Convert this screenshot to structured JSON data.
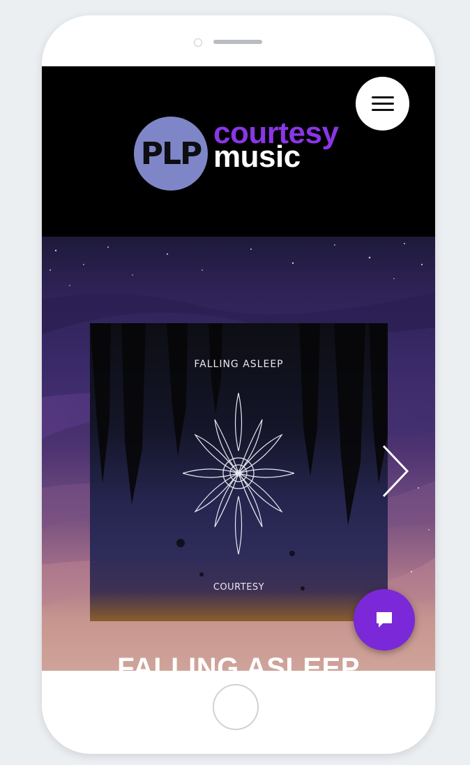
{
  "header": {
    "menu_icon": "hamburger-menu-icon",
    "logo": {
      "monogram": "PLP",
      "line1": "courtesy",
      "line2": "music"
    }
  },
  "hero": {
    "album": {
      "title": "FALLING ASLEEP",
      "artist": "COURTESY",
      "emblem_icon": "mandala-icon"
    },
    "next_icon": "chevron-right-icon",
    "song_title": "FALLING ASLEEP"
  },
  "chat": {
    "icon": "chat-bubble-icon"
  },
  "colors": {
    "brand_purple": "#8a36e6",
    "logo_circle": "#7e86c7",
    "chat_button": "#7a28d8"
  }
}
